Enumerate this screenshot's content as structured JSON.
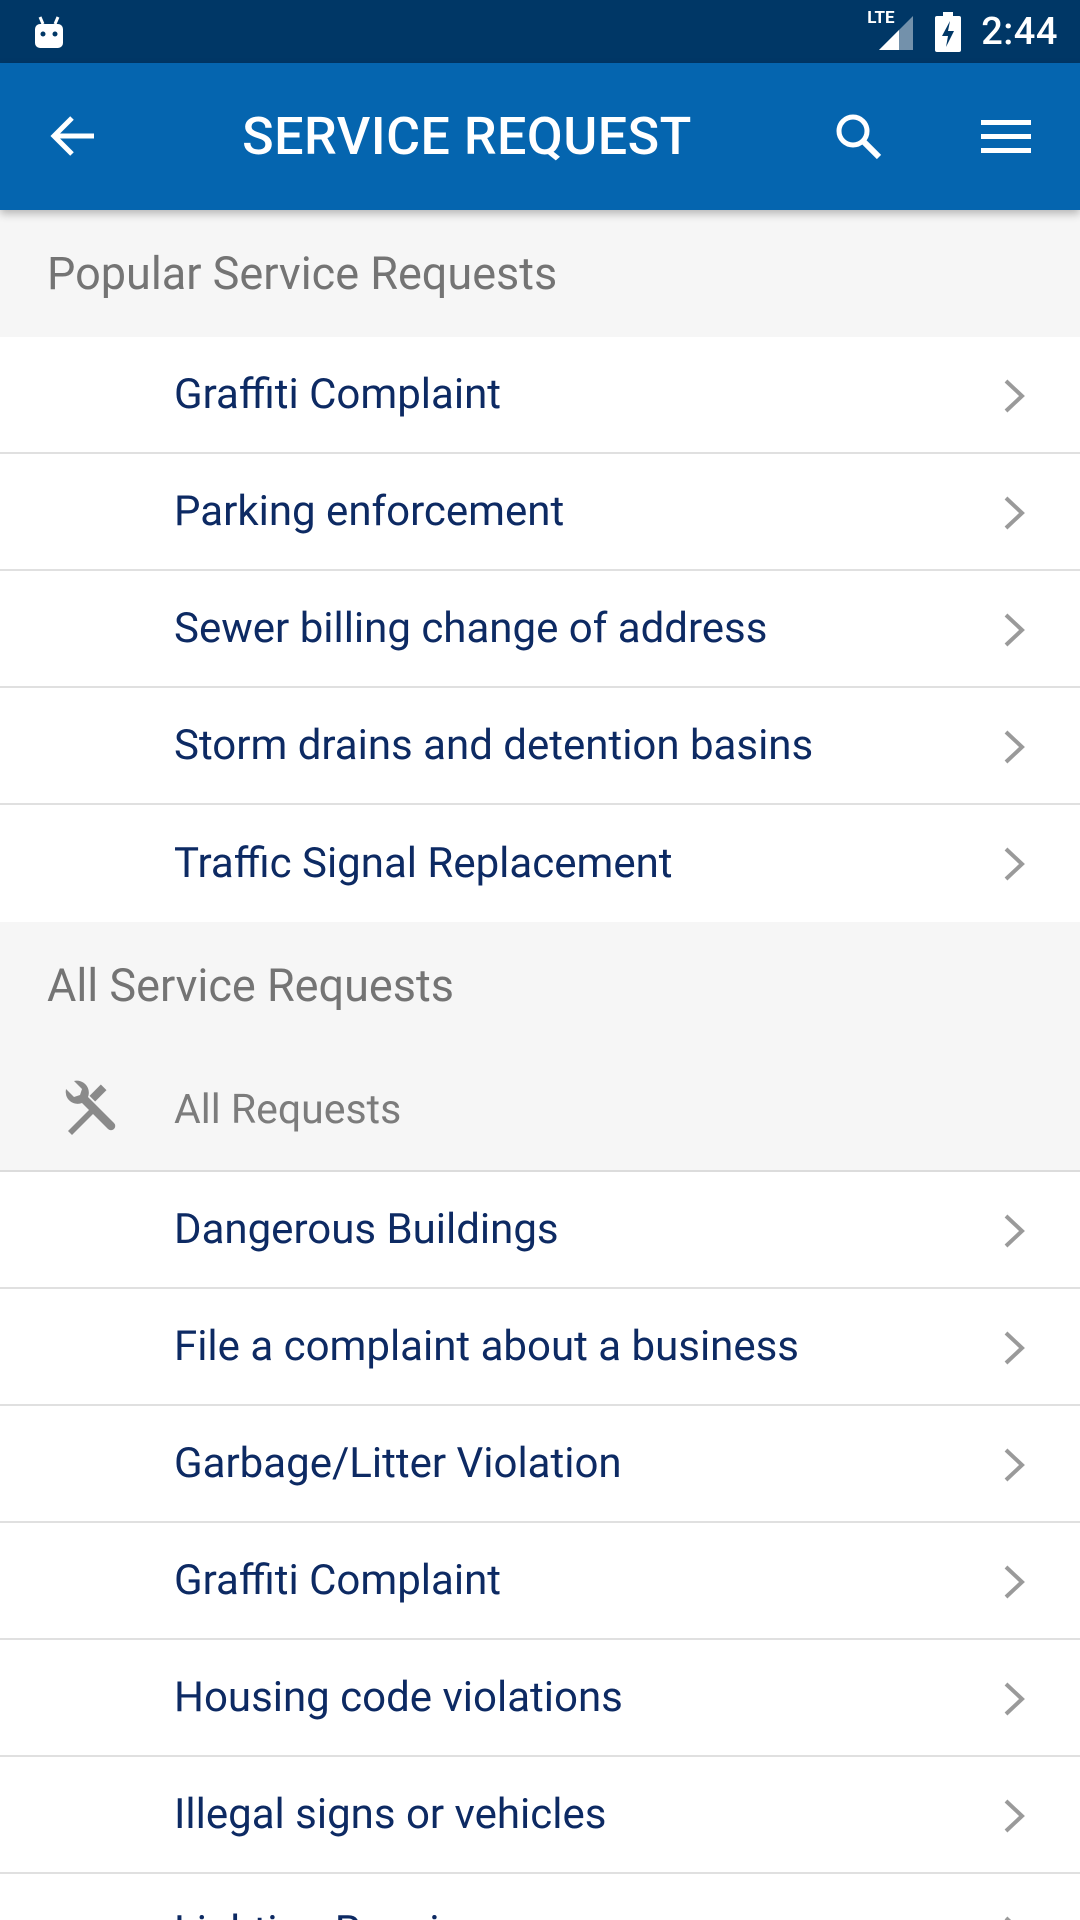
{
  "status_bar": {
    "time": "2:44",
    "network_label": "LTE",
    "icons": [
      "android-notification-icon",
      "lte-signal-icon",
      "battery-charging-icon"
    ]
  },
  "app_bar": {
    "title": "SERVICE REQUEST",
    "icons": [
      "back-arrow-icon",
      "search-icon",
      "hamburger-menu-icon"
    ]
  },
  "popular": {
    "header": "Popular Service Requests",
    "items": [
      {
        "label": "Graffiti Complaint"
      },
      {
        "label": "Parking enforcement"
      },
      {
        "label": "Sewer billing change of address"
      },
      {
        "label": "Storm drains and detention basins"
      },
      {
        "label": "Traffic Signal Replacement"
      }
    ]
  },
  "all": {
    "header": "All Service Requests",
    "group": {
      "label": "All Requests",
      "icon": "tools-icon"
    },
    "items": [
      {
        "label": "Dangerous Buildings"
      },
      {
        "label": "File a complaint about a business"
      },
      {
        "label": "Garbage/Litter Violation"
      },
      {
        "label": "Graffiti Complaint"
      },
      {
        "label": "Housing code violations"
      },
      {
        "label": "Illegal signs or vehicles"
      },
      {
        "label": "Lighting Repair"
      }
    ]
  },
  "colors": {
    "status_bar": "#003766",
    "app_bar": "#0565af",
    "item_text": "#0d2a63",
    "section_bg": "#f6f6f6",
    "header_text": "#747474"
  }
}
